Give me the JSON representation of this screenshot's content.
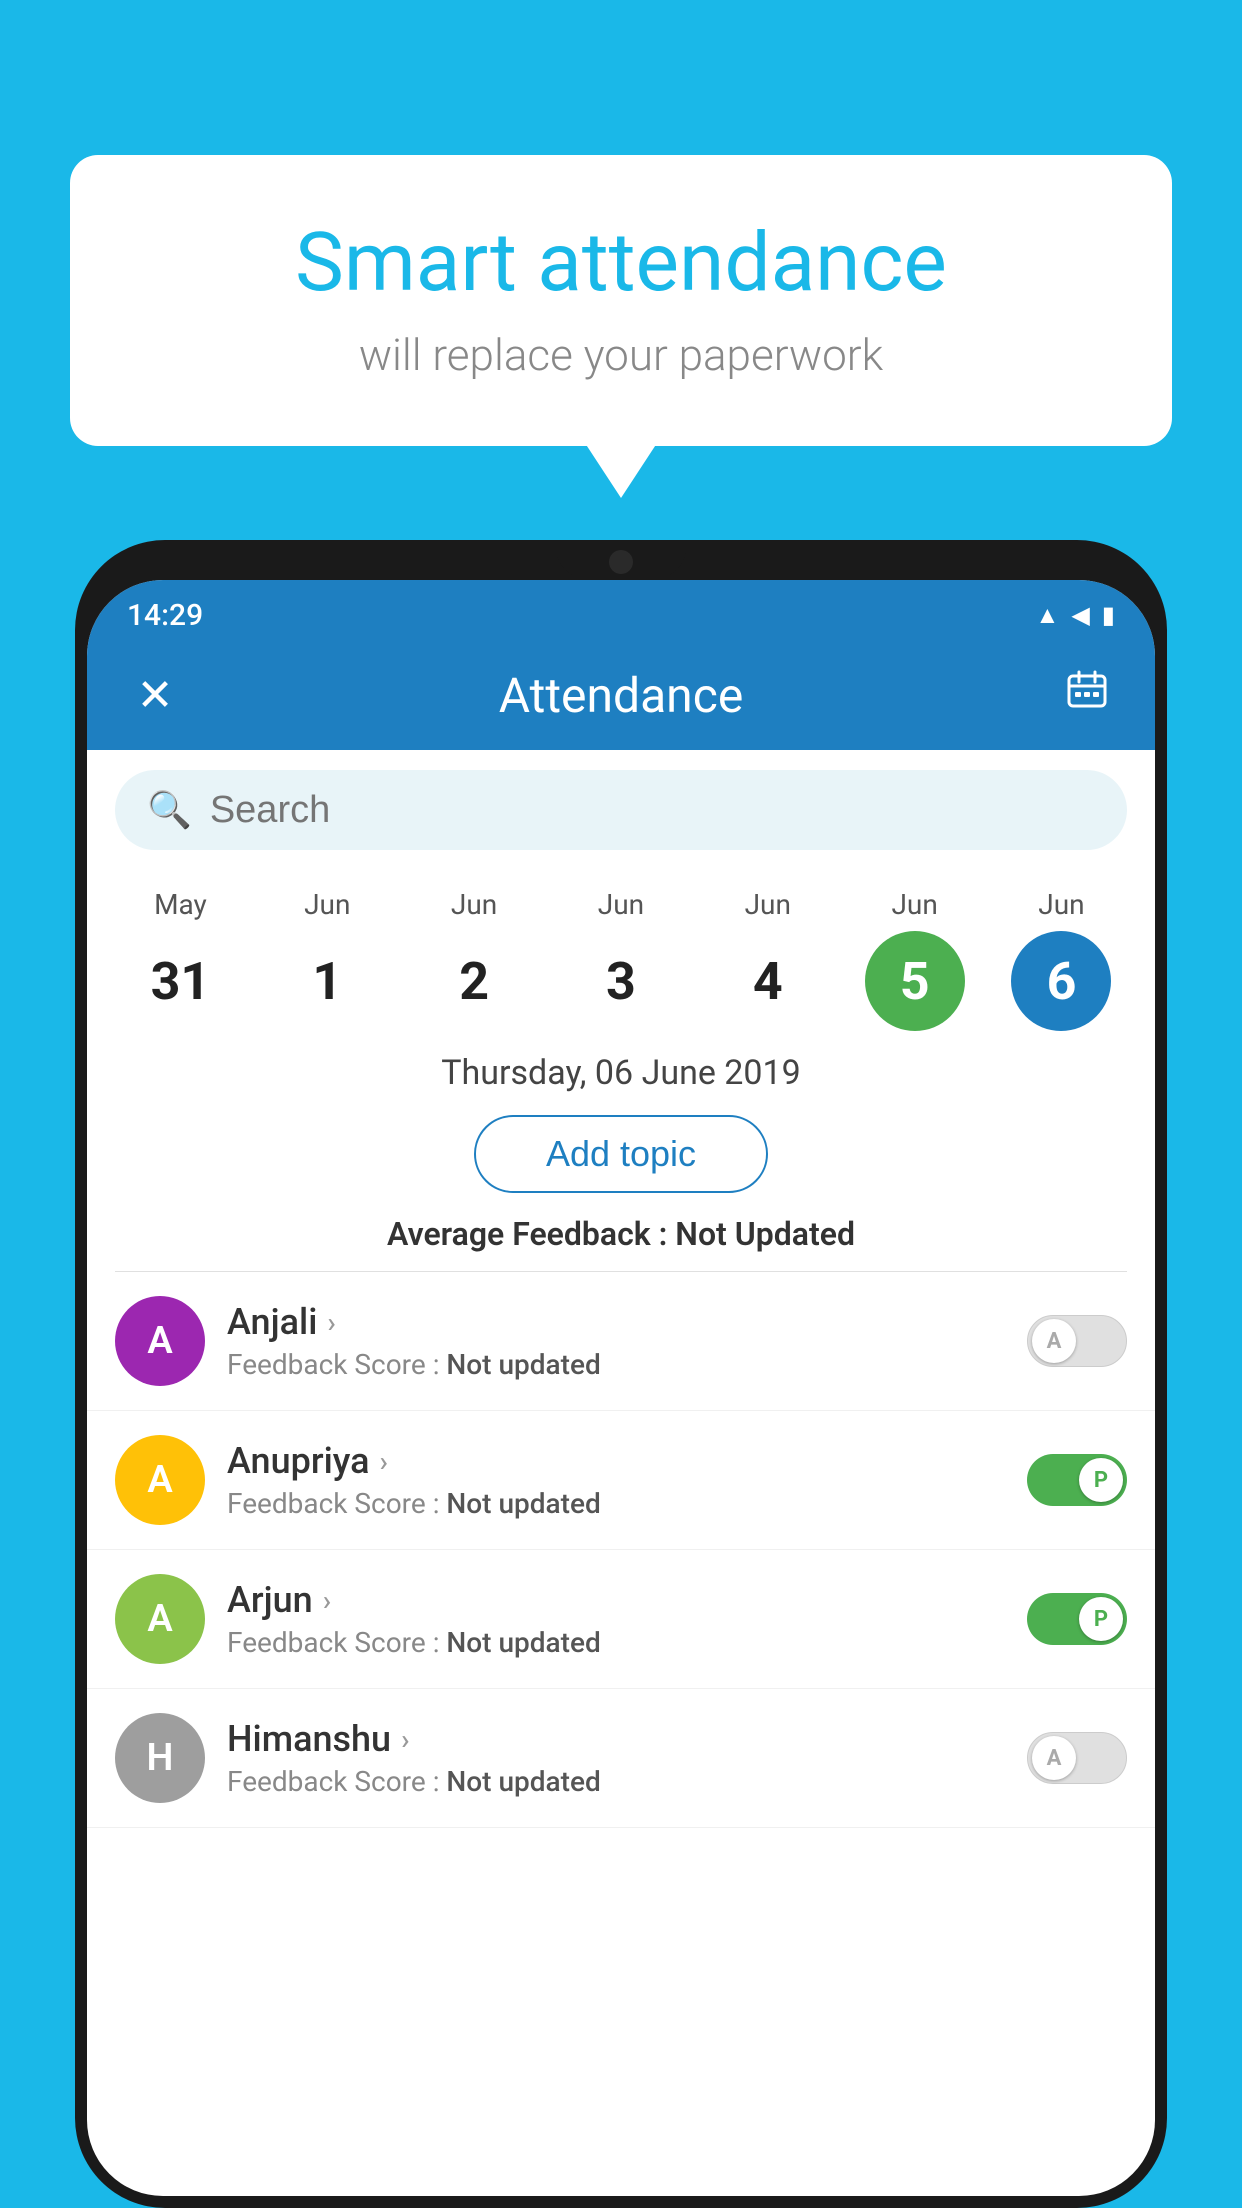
{
  "background_color": "#1ab8e8",
  "bubble": {
    "title": "Smart attendance",
    "subtitle": "will replace your paperwork"
  },
  "status_bar": {
    "time": "14:29",
    "icons": [
      "wifi",
      "signal",
      "battery"
    ]
  },
  "app_bar": {
    "title": "Attendance",
    "close_icon": "✕",
    "calendar_icon": "📅"
  },
  "search": {
    "placeholder": "Search"
  },
  "calendar": {
    "days": [
      {
        "month": "May",
        "date": "31",
        "state": "normal"
      },
      {
        "month": "Jun",
        "date": "1",
        "state": "normal"
      },
      {
        "month": "Jun",
        "date": "2",
        "state": "normal"
      },
      {
        "month": "Jun",
        "date": "3",
        "state": "normal"
      },
      {
        "month": "Jun",
        "date": "4",
        "state": "normal"
      },
      {
        "month": "Jun",
        "date": "5",
        "state": "today"
      },
      {
        "month": "Jun",
        "date": "6",
        "state": "selected"
      }
    ],
    "selected_date_label": "Thursday, 06 June 2019"
  },
  "add_topic": {
    "label": "Add topic"
  },
  "average_feedback": {
    "label": "Average Feedback :",
    "value": "Not Updated"
  },
  "students": [
    {
      "name": "Anjali",
      "avatar_letter": "A",
      "avatar_color": "#9c27b0",
      "feedback_label": "Feedback Score :",
      "feedback_value": "Not updated",
      "toggle_state": "off",
      "toggle_label": "A"
    },
    {
      "name": "Anupriya",
      "avatar_letter": "A",
      "avatar_color": "#ffc107",
      "feedback_label": "Feedback Score :",
      "feedback_value": "Not updated",
      "toggle_state": "on",
      "toggle_label": "P"
    },
    {
      "name": "Arjun",
      "avatar_letter": "A",
      "avatar_color": "#8bc34a",
      "feedback_label": "Feedback Score :",
      "feedback_value": "Not updated",
      "toggle_state": "on",
      "toggle_label": "P"
    },
    {
      "name": "Himanshu",
      "avatar_letter": "H",
      "avatar_color": "#9e9e9e",
      "feedback_label": "Feedback Score :",
      "feedback_value": "Not updated",
      "toggle_state": "off",
      "toggle_label": "A"
    }
  ]
}
